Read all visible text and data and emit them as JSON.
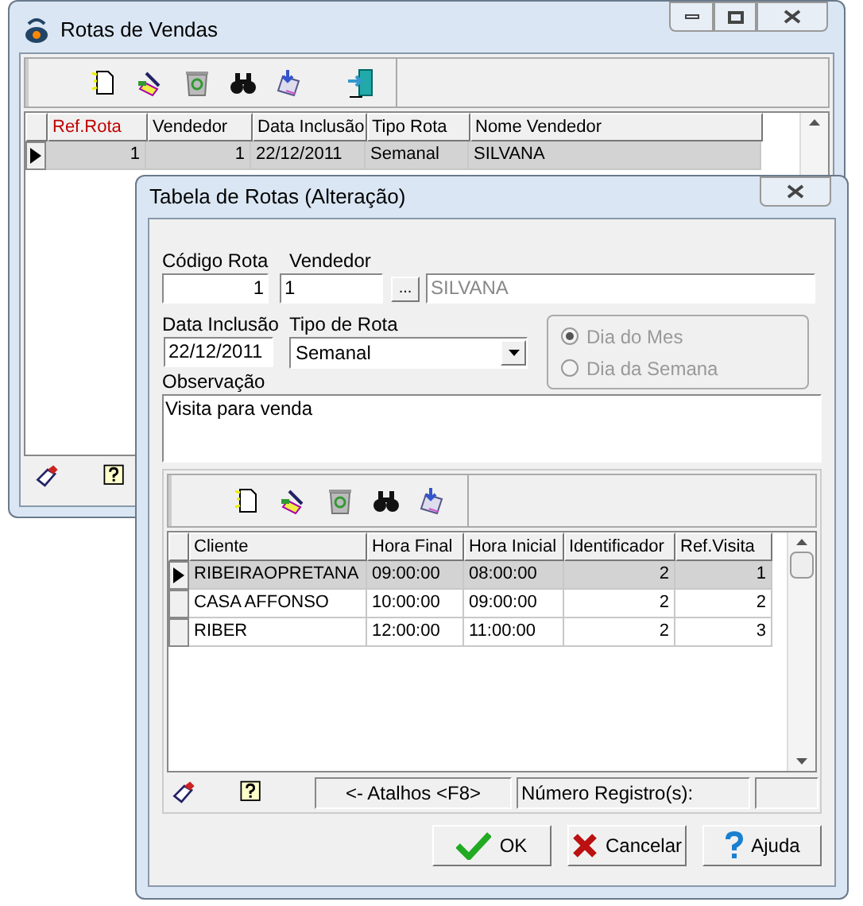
{
  "back_window": {
    "title": "Rotas de Vendas",
    "grid": {
      "columns": [
        {
          "label": "Ref.Rota",
          "sorted": true
        },
        {
          "label": "Vendedor",
          "sorted": false
        },
        {
          "label": "Data Inclusão",
          "sorted": false
        },
        {
          "label": "Tipo Rota",
          "sorted": false
        },
        {
          "label": "Nome Vendedor",
          "sorted": false
        }
      ],
      "rows": [
        {
          "selected": true,
          "cells": [
            "1",
            "1",
            "22/12/2011",
            "Semanal",
            "SILVANA"
          ]
        }
      ]
    }
  },
  "front_window": {
    "title": "Tabela de Rotas (Alteração)",
    "codigo_rota": {
      "label": "Código Rota",
      "value": "1"
    },
    "vendedor": {
      "label": "Vendedor",
      "value": "1",
      "lookup_button": "...",
      "name": "SILVANA"
    },
    "data_inclusao": {
      "label": "Data Inclusão",
      "value": "22/12/2011"
    },
    "tipo_rota": {
      "label": "Tipo de Rota",
      "value": "Semanal"
    },
    "radio_group": {
      "disabled": true,
      "options": [
        {
          "label": "Dia do Mes",
          "selected": true
        },
        {
          "label": "Dia da Semana",
          "selected": false
        }
      ]
    },
    "observacao": {
      "label": "Observação",
      "value": "Visita para venda"
    },
    "grid": {
      "columns": [
        "Cliente",
        "Hora Final",
        "Hora Inicial",
        "Identificador",
        "Ref.Visita"
      ],
      "rows": [
        {
          "selected": true,
          "cells": [
            "RIBEIRAOPRETANA",
            "09:00:00",
            "08:00:00",
            "2",
            "1"
          ]
        },
        {
          "selected": false,
          "cells": [
            "CASA AFFONSO",
            "10:00:00",
            "09:00:00",
            "2",
            "2"
          ]
        },
        {
          "selected": false,
          "cells": [
            "RIBER",
            "12:00:00",
            "11:00:00",
            "2",
            "3"
          ]
        }
      ]
    },
    "status_bar": [
      "<- Atalhos <F8>",
      "Número Registro(s):"
    ],
    "buttons": [
      {
        "kind": "ok",
        "label": "OK"
      },
      {
        "kind": "cancel",
        "label": "Cancelar"
      },
      {
        "kind": "help",
        "label": "Ajuda"
      }
    ]
  }
}
